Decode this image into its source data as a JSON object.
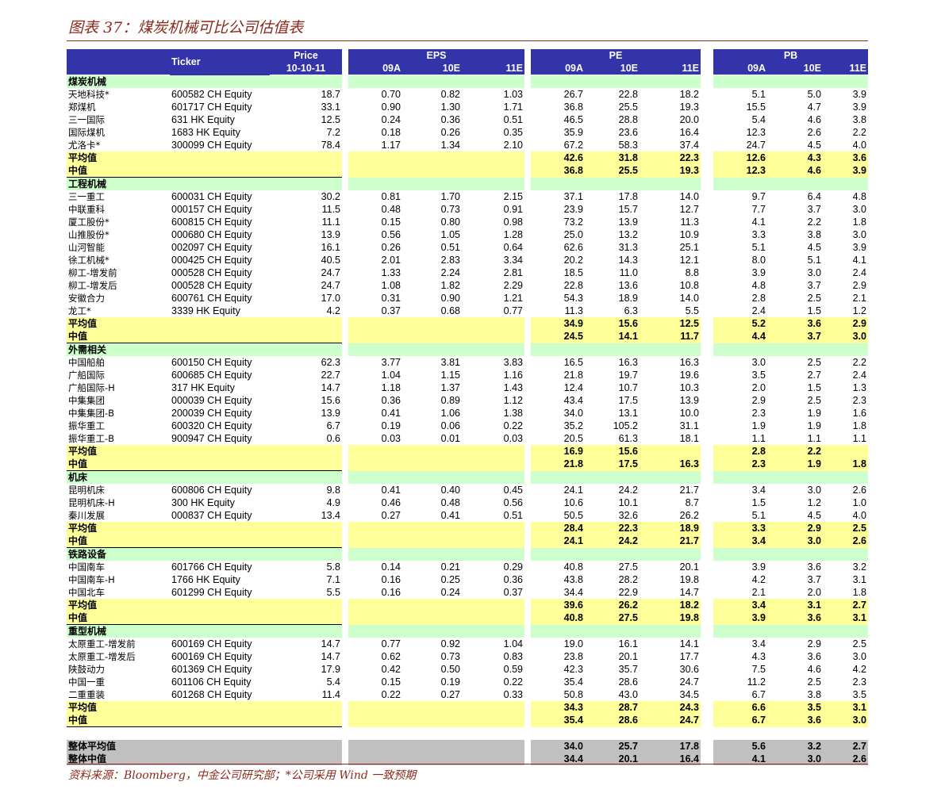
{
  "title": "图表 37：煤炭机械可比公司估值表",
  "source": "资料来源：Bloomberg，中金公司研究部；*公司采用 Wind 一致预期",
  "header": {
    "ticker": "Ticker",
    "price_top": "Price",
    "price_date": "10-10-11",
    "eps": "EPS",
    "pe": "PE",
    "pb": "PB",
    "years": [
      "09A",
      "10E",
      "11E"
    ]
  },
  "groups": [
    {
      "name": "煤炭机械",
      "rows": [
        [
          "天地科技*",
          "600582 CH Equity",
          "18.7",
          "0.70",
          "0.82",
          "1.03",
          "26.7",
          "22.8",
          "18.2",
          "5.1",
          "5.0",
          "3.9"
        ],
        [
          "郑煤机",
          "601717 CH Equity",
          "33.1",
          "0.90",
          "1.30",
          "1.71",
          "36.8",
          "25.5",
          "19.3",
          "15.5",
          "4.7",
          "3.9"
        ],
        [
          "三一国际",
          "631 HK Equity",
          "12.5",
          "0.24",
          "0.36",
          "0.51",
          "46.5",
          "28.8",
          "20.0",
          "5.4",
          "4.6",
          "3.8"
        ],
        [
          "国际煤机",
          "1683 HK Equity",
          "7.2",
          "0.18",
          "0.26",
          "0.35",
          "35.9",
          "23.6",
          "16.4",
          "12.3",
          "2.6",
          "2.2"
        ],
        [
          "尤洛卡*",
          "300099 CH Equity",
          "78.4",
          "1.17",
          "1.34",
          "2.10",
          "67.2",
          "58.3",
          "37.4",
          "24.7",
          "4.5",
          "4.0"
        ]
      ],
      "avg": [
        "42.6",
        "31.8",
        "22.3",
        "12.6",
        "4.3",
        "3.6"
      ],
      "median": [
        "36.8",
        "25.5",
        "19.3",
        "12.3",
        "4.6",
        "3.9"
      ]
    },
    {
      "name": "工程机械",
      "rows": [
        [
          "三一重工",
          "600031 CH Equity",
          "30.2",
          "0.81",
          "1.70",
          "2.15",
          "37.1",
          "17.8",
          "14.0",
          "9.7",
          "6.4",
          "4.8"
        ],
        [
          "中联重科",
          "000157 CH Equity",
          "11.5",
          "0.48",
          "0.73",
          "0.91",
          "23.9",
          "15.7",
          "12.7",
          "7.7",
          "3.7",
          "3.0"
        ],
        [
          "厦工股份*",
          "600815 CH Equity",
          "11.1",
          "0.15",
          "0.80",
          "0.98",
          "73.2",
          "13.9",
          "11.3",
          "4.1",
          "2.2",
          "1.8"
        ],
        [
          "山推股份*",
          "000680 CH Equity",
          "13.9",
          "0.56",
          "1.05",
          "1.28",
          "25.0",
          "13.2",
          "10.9",
          "3.3",
          "3.8",
          "3.0"
        ],
        [
          "山河智能",
          "002097 CH Equity",
          "16.1",
          "0.26",
          "0.51",
          "0.64",
          "62.6",
          "31.3",
          "25.1",
          "5.1",
          "4.5",
          "3.9"
        ],
        [
          "徐工机械*",
          "000425 CH Equity",
          "40.5",
          "2.01",
          "2.83",
          "3.34",
          "20.2",
          "14.3",
          "12.1",
          "8.0",
          "5.1",
          "4.1"
        ],
        [
          "柳工-增发前",
          "000528 CH Equity",
          "24.7",
          "1.33",
          "2.24",
          "2.81",
          "18.5",
          "11.0",
          "8.8",
          "3.9",
          "3.0",
          "2.4"
        ],
        [
          "柳工-增发后",
          "000528 CH Equity",
          "24.7",
          "1.08",
          "1.82",
          "2.29",
          "22.8",
          "13.6",
          "10.8",
          "4.8",
          "3.7",
          "2.9"
        ],
        [
          "安徽合力",
          "600761 CH Equity",
          "17.0",
          "0.31",
          "0.90",
          "1.21",
          "54.3",
          "18.9",
          "14.0",
          "2.8",
          "2.5",
          "2.1"
        ],
        [
          "龙工*",
          "3339 HK Equity",
          "4.2",
          "0.37",
          "0.68",
          "0.77",
          "11.3",
          "6.3",
          "5.5",
          "2.4",
          "1.5",
          "1.2"
        ]
      ],
      "avg": [
        "34.9",
        "15.6",
        "12.5",
        "5.2",
        "3.6",
        "2.9"
      ],
      "median": [
        "24.5",
        "14.1",
        "11.7",
        "4.4",
        "3.7",
        "3.0"
      ]
    },
    {
      "name": "外需相关",
      "rows": [
        [
          "中国船舶",
          "600150 CH Equity",
          "62.3",
          "3.77",
          "3.81",
          "3.83",
          "16.5",
          "16.3",
          "16.3",
          "3.0",
          "2.5",
          "2.2"
        ],
        [
          "广船国际",
          "600685 CH Equity",
          "22.7",
          "1.04",
          "1.15",
          "1.16",
          "21.8",
          "19.7",
          "19.6",
          "3.5",
          "2.7",
          "2.4"
        ],
        [
          "广船国际-H",
          "317 HK Equity",
          "14.7",
          "1.18",
          "1.37",
          "1.43",
          "12.4",
          "10.7",
          "10.3",
          "2.0",
          "1.5",
          "1.3"
        ],
        [
          "中集集团",
          "000039 CH Equity",
          "15.6",
          "0.36",
          "0.89",
          "1.12",
          "43.4",
          "17.5",
          "13.9",
          "2.9",
          "2.5",
          "2.3"
        ],
        [
          "中集集团-B",
          "200039 CH Equity",
          "13.9",
          "0.41",
          "1.06",
          "1.38",
          "34.0",
          "13.1",
          "10.0",
          "2.3",
          "1.9",
          "1.6"
        ],
        [
          "振华重工",
          "600320 CH Equity",
          "6.7",
          "0.19",
          "0.06",
          "0.22",
          "35.2",
          "105.2",
          "31.1",
          "1.9",
          "1.9",
          "1.8"
        ],
        [
          "振华重工-B",
          "900947 CH Equity",
          "0.6",
          "0.03",
          "0.01",
          "0.03",
          "20.5",
          "61.3",
          "18.1",
          "1.1",
          "1.1",
          "1.1"
        ]
      ],
      "avg": [
        "16.9",
        "15.6",
        "",
        "2.8",
        "2.2",
        ""
      ],
      "median": [
        "21.8",
        "17.5",
        "16.3",
        "2.3",
        "1.9",
        "1.8"
      ]
    },
    {
      "name": "机床",
      "rows": [
        [
          "昆明机床",
          "600806 CH Equity",
          "9.8",
          "0.41",
          "0.40",
          "0.45",
          "24.1",
          "24.2",
          "21.7",
          "3.4",
          "3.0",
          "2.6"
        ],
        [
          "昆明机床-H",
          "300 HK Equity",
          "4.9",
          "0.46",
          "0.48",
          "0.56",
          "10.6",
          "10.1",
          "8.7",
          "1.5",
          "1.2",
          "1.0"
        ],
        [
          "秦川发展",
          "000837 CH Equity",
          "13.4",
          "0.27",
          "0.41",
          "0.51",
          "50.5",
          "32.6",
          "26.2",
          "5.1",
          "4.5",
          "4.0"
        ]
      ],
      "avg": [
        "28.4",
        "22.3",
        "18.9",
        "3.3",
        "2.9",
        "2.5"
      ],
      "median": [
        "24.1",
        "24.2",
        "21.7",
        "3.4",
        "3.0",
        "2.6"
      ]
    },
    {
      "name": "铁路设备",
      "rows": [
        [
          "中国南车",
          "601766 CH Equity",
          "5.8",
          "0.14",
          "0.21",
          "0.29",
          "40.8",
          "27.5",
          "20.1",
          "3.9",
          "3.6",
          "3.2"
        ],
        [
          "中国南车-H",
          "1766 HK Equity",
          "7.1",
          "0.16",
          "0.25",
          "0.36",
          "43.8",
          "28.2",
          "19.8",
          "4.2",
          "3.7",
          "3.1"
        ],
        [
          "中国北车",
          "601299 CH Equity",
          "5.5",
          "0.16",
          "0.24",
          "0.37",
          "34.4",
          "22.9",
          "14.7",
          "2.1",
          "2.0",
          "1.8"
        ]
      ],
      "avg": [
        "39.6",
        "26.2",
        "18.2",
        "3.4",
        "3.1",
        "2.7"
      ],
      "median": [
        "40.8",
        "27.5",
        "19.8",
        "3.9",
        "3.6",
        "3.1"
      ]
    },
    {
      "name": "重型机械",
      "rows": [
        [
          "太原重工-增发前",
          "600169 CH Equity",
          "14.7",
          "0.77",
          "0.92",
          "1.04",
          "19.0",
          "16.1",
          "14.1",
          "3.4",
          "2.9",
          "2.5"
        ],
        [
          "太原重工-增发后",
          "600169 CH Equity",
          "14.7",
          "0.62",
          "0.73",
          "0.83",
          "23.8",
          "20.1",
          "17.7",
          "4.3",
          "3.6",
          "3.0"
        ],
        [
          "陕鼓动力",
          "601369 CH Equity",
          "17.9",
          "0.42",
          "0.50",
          "0.59",
          "42.3",
          "35.7",
          "30.6",
          "7.5",
          "4.6",
          "4.2"
        ],
        [
          "中国一重",
          "601106 CH Equity",
          "5.4",
          "0.15",
          "0.19",
          "0.22",
          "35.4",
          "28.6",
          "24.7",
          "11.2",
          "2.5",
          "2.3"
        ],
        [
          "二重重装",
          "601268 CH Equity",
          "11.4",
          "0.22",
          "0.27",
          "0.33",
          "50.8",
          "43.0",
          "34.5",
          "6.7",
          "3.8",
          "3.5"
        ]
      ],
      "avg": [
        "34.3",
        "28.7",
        "24.3",
        "6.6",
        "3.5",
        "3.1"
      ],
      "median": [
        "35.4",
        "28.6",
        "24.7",
        "6.7",
        "3.6",
        "3.0"
      ]
    }
  ],
  "labels": {
    "avg": "平均值",
    "median": "中值",
    "overall_avg": "整体平均值",
    "overall_median": "整体中值"
  },
  "overall": {
    "avg": [
      "34.0",
      "25.7",
      "17.8",
      "5.6",
      "3.2",
      "2.7"
    ],
    "median": [
      "34.4",
      "20.1",
      "16.4",
      "4.1",
      "3.0",
      "2.6"
    ]
  },
  "colors": {
    "header": "#3333aa",
    "group": "#ccffcc",
    "average": "#ffff99",
    "overall": "#c0c0c0",
    "accent": "#8b2a1c"
  }
}
